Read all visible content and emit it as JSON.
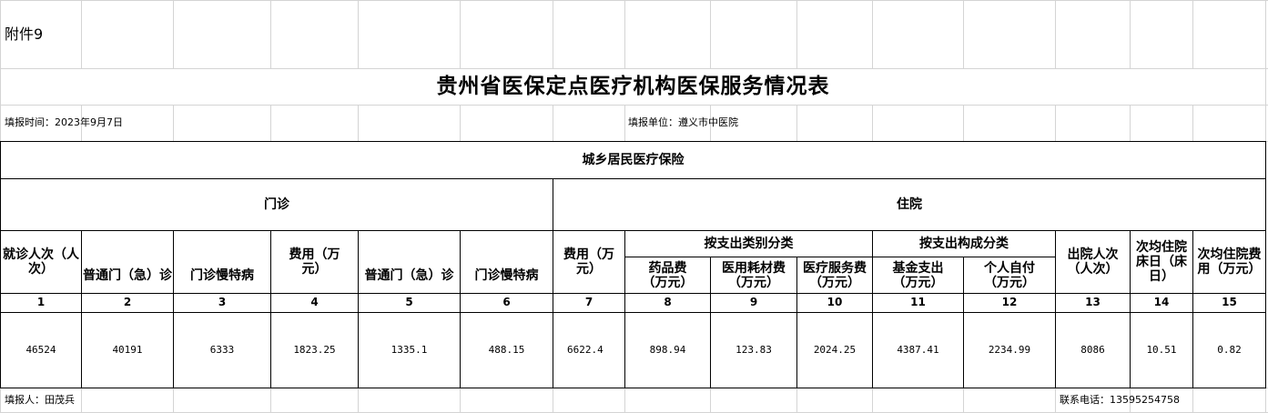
{
  "attachment_label": "附件9",
  "title": "贵州省医保定点医疗机构医保服务情况表",
  "fill_date": "填报时间：2023年9月7日",
  "fill_unit": "填报单位：遵义市中医院",
  "section_title": "城乡居民医疗保险",
  "outpatient": {
    "label": "门诊",
    "visits": "就诊人次（人次）",
    "regular_count": "普通门（急）诊",
    "chronic_count": "门诊慢特病",
    "cost": "费用（万元）",
    "regular_cost": "普通门（急）诊",
    "chronic_cost": "门诊慢特病"
  },
  "inpatient": {
    "label": "住院",
    "cost": "费用（万元）",
    "by_category": "按支出类别分类",
    "drug": "药品费（万元）",
    "consumable": "医用耗材费（万元）",
    "service": "医疗服务费（万元）",
    "by_composition": "按支出构成分类",
    "fund": "基金支出（万元）",
    "self_pay": "个人自付（万元）",
    "discharges": "出院人次（人次）",
    "avg_bed_days": "次均住院床日（床日）",
    "avg_cost": "次均住院费用（万元）"
  },
  "col_numbers": [
    "1",
    "2",
    "3",
    "4",
    "5",
    "6",
    "7",
    "8",
    "9",
    "10",
    "11",
    "12",
    "13",
    "14",
    "15"
  ],
  "values": [
    "46524",
    "40191",
    "6333",
    "1823.25",
    "1335.1",
    "488.15",
    "6622.4",
    "898.94",
    "123.83",
    "2024.25",
    "4387.41",
    "2234.99",
    "8086",
    "10.51",
    "0.82"
  ],
  "filler": "填报人：田茂兵",
  "phone": "联系电话：13595254758"
}
